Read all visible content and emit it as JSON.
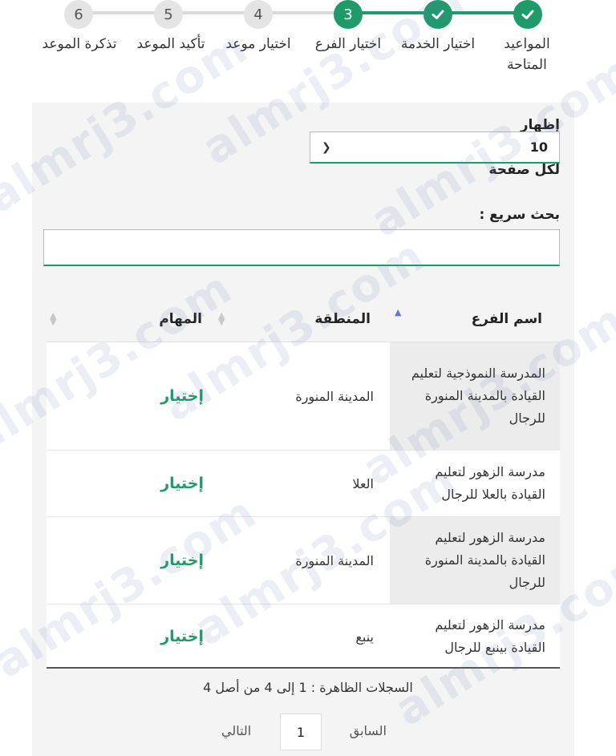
{
  "colors": {
    "accent": "#1f9a6a",
    "inactive_step": "#e4e4e4",
    "sort_active": "#6b74c9"
  },
  "watermark": "almrj3.com",
  "steps": [
    {
      "number": "",
      "label": "المواعيد المتاحة",
      "state": "done",
      "icon": "check-icon"
    },
    {
      "number": "",
      "label": "اختيار الخدمة",
      "state": "done",
      "icon": "check-icon"
    },
    {
      "number": "3",
      "label": "اختيار الفرع",
      "state": "active"
    },
    {
      "number": "4",
      "label": "اختيار موعد",
      "state": "pending"
    },
    {
      "number": "5",
      "label": "تأكيد الموعد",
      "state": "pending"
    },
    {
      "number": "6",
      "label": "تذكرة الموعد",
      "state": "pending"
    }
  ],
  "page_length": {
    "label_show": "إظهار",
    "value": "10",
    "label_per_page": "لكل صفحة",
    "icon": "chevron-down-icon"
  },
  "search": {
    "label": "بحث سريع :",
    "value": "",
    "placeholder": ""
  },
  "table": {
    "headers": {
      "branch": "اسم الفرع",
      "region": "المنطقة",
      "actions": "المهام"
    },
    "rows": [
      {
        "branch": "المدرسة النموذجية لتعليم القيادة بالمدينة المنورة للرجال",
        "region": "المدينة المنورة",
        "action": "إختيار"
      },
      {
        "branch": "مدرسة الزهور لتعليم القيادة بالعلا للرجال",
        "region": "العلا",
        "action": "إختيار"
      },
      {
        "branch": "مدرسة الزهور لتعليم القيادة بالمدينة المنورة للرجال",
        "region": "المدينة المنورة",
        "action": "إختيار"
      },
      {
        "branch": "مدرسة الزهور لتعليم القيادة بينبع للرجال",
        "region": "ينبع",
        "action": "إختيار"
      }
    ]
  },
  "info": "السجلات الظاهرة : 1 إلى 4 من أصل 4",
  "pagination": {
    "previous": "السابق",
    "current_page": "1",
    "next": "التالي"
  }
}
